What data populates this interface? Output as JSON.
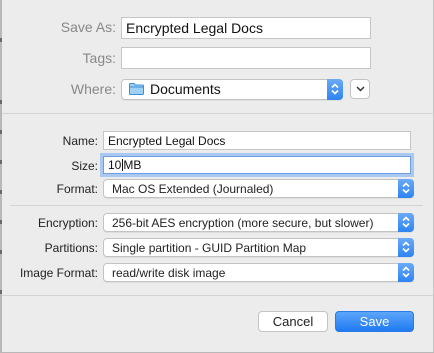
{
  "save_as": {
    "label": "Save As:",
    "value": "Encrypted Legal Docs"
  },
  "tags": {
    "label": "Tags:",
    "value": ""
  },
  "where": {
    "label": "Where:",
    "value": "Documents"
  },
  "name": {
    "label": "Name:",
    "value": "Encrypted Legal Docs"
  },
  "size": {
    "label": "Size:",
    "value": "10",
    "unit": "MB"
  },
  "format": {
    "label": "Format:",
    "value": "Mac OS Extended (Journaled)"
  },
  "encryption": {
    "label": "Encryption:",
    "value": "256-bit AES encryption (more secure, but slower)"
  },
  "partitions": {
    "label": "Partitions:",
    "value": "Single partition - GUID Partition Map"
  },
  "image_format": {
    "label": "Image Format:",
    "value": "read/write disk image"
  },
  "buttons": {
    "cancel": "Cancel",
    "save": "Save"
  },
  "colors": {
    "accent": "#2e84f2",
    "focus_ring": "#a9c8f2",
    "folder": "#4aa3e8"
  },
  "icons": {
    "folder": "folder-icon",
    "disclosure": "chevron-down-icon",
    "stepper": "up-down-arrows-icon"
  }
}
